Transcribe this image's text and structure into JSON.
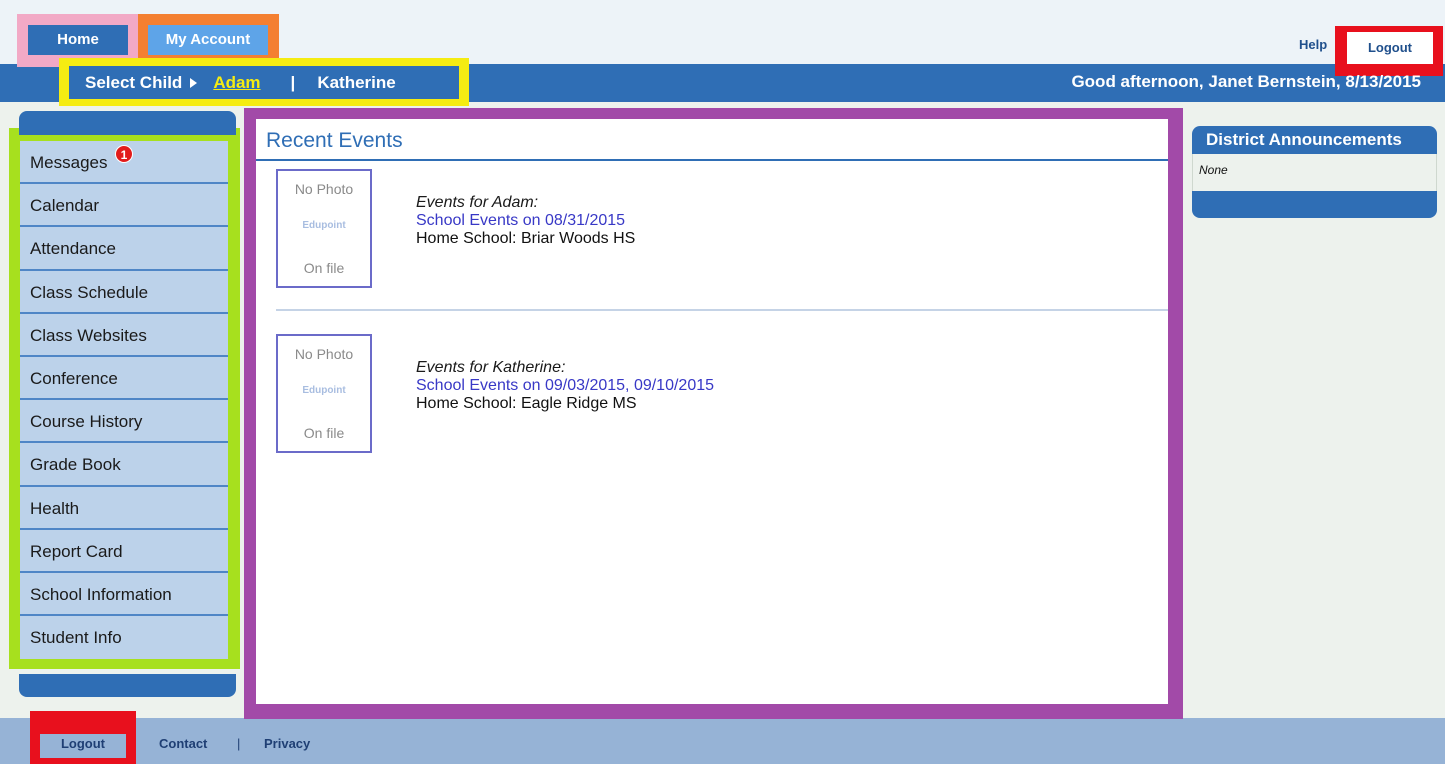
{
  "header": {
    "home_label": "Home",
    "account_label": "My Account",
    "help_label": "Help",
    "logout_label": "Logout",
    "greeting": "Good afternoon, Janet Bernstein, 8/13/2015"
  },
  "child_selector": {
    "label": "Select Child",
    "children": [
      "Adam",
      "Katherine"
    ],
    "separator": "|",
    "selected": "Adam"
  },
  "sidebar": {
    "items": [
      {
        "label": "Messages",
        "badge": "1"
      },
      {
        "label": "Calendar"
      },
      {
        "label": "Attendance"
      },
      {
        "label": "Class Schedule"
      },
      {
        "label": "Class Websites"
      },
      {
        "label": "Conference"
      },
      {
        "label": "Course History"
      },
      {
        "label": "Grade Book"
      },
      {
        "label": "Health"
      },
      {
        "label": "Report Card"
      },
      {
        "label": "School Information"
      },
      {
        "label": "Student Info"
      }
    ]
  },
  "main": {
    "title": "Recent Events",
    "events": [
      {
        "photo_line1": "No Photo",
        "photo_logo": "Edupoint",
        "photo_line2": "On file",
        "for_label": "Events for Adam:",
        "link": "School Events on 08/31/2015",
        "school": "Home School: Briar Woods HS"
      },
      {
        "photo_line1": "No Photo",
        "photo_logo": "Edupoint",
        "photo_line2": "On file",
        "for_label": "Events for Katherine:",
        "link": "School Events on 09/03/2015, 09/10/2015",
        "school": "Home School: Eagle Ridge MS"
      }
    ]
  },
  "announcements": {
    "title": "District Announcements",
    "body": "None"
  },
  "footer": {
    "logout_label": "Logout",
    "contact_label": "Contact",
    "separator": "|",
    "privacy_label": "Privacy"
  },
  "colors": {
    "primary_blue": "#2f6eb5",
    "highlight_pink": "#f2a9c6",
    "highlight_orange": "#f47f31",
    "highlight_red": "#e8101d",
    "highlight_yellow": "#f5ec12",
    "highlight_green": "#a7e01e",
    "highlight_purple": "#a24aa8"
  }
}
